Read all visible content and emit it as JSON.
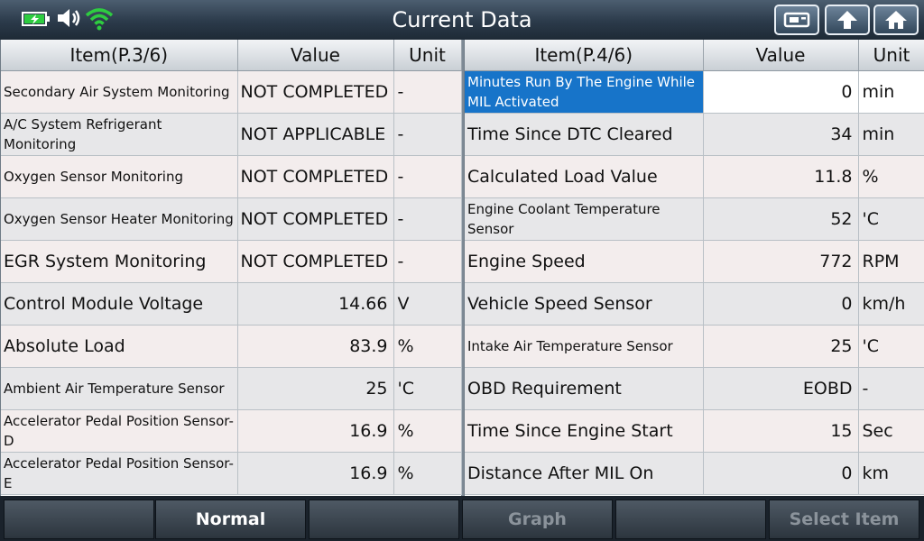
{
  "header": {
    "title": "Current Data"
  },
  "left": {
    "headers": {
      "item": "Item(P.3/6)",
      "value": "Value",
      "unit": "Unit"
    },
    "rows": [
      {
        "item": "Secondary Air System Monitoring",
        "value": "NOT COMPLETED",
        "unit": "-"
      },
      {
        "item": "A/C System Refrigerant Monitoring",
        "value": "NOT APPLICABLE",
        "unit": "-"
      },
      {
        "item": "Oxygen Sensor Monitoring",
        "value": "NOT COMPLETED",
        "unit": "-"
      },
      {
        "item": "Oxygen Sensor Heater Monitoring",
        "value": "NOT COMPLETED",
        "unit": "-"
      },
      {
        "item": "EGR System Monitoring",
        "value": "NOT COMPLETED",
        "unit": "-"
      },
      {
        "item": "Control Module Voltage",
        "value": "14.66",
        "unit": "V"
      },
      {
        "item": "Absolute Load",
        "value": "83.9",
        "unit": "%"
      },
      {
        "item": "Ambient Air Temperature Sensor",
        "value": "25",
        "unit": "'C"
      },
      {
        "item": "Accelerator Pedal Position Sensor-D",
        "value": "16.9",
        "unit": "%"
      },
      {
        "item": "Accelerator Pedal Position Sensor-E",
        "value": "16.9",
        "unit": "%"
      }
    ]
  },
  "right": {
    "headers": {
      "item": "Item(P.4/6)",
      "value": "Value",
      "unit": "Unit"
    },
    "rows": [
      {
        "item": "Minutes Run By The Engine While MIL Activated",
        "value": "0",
        "unit": "min"
      },
      {
        "item": "Time Since DTC Cleared",
        "value": "34",
        "unit": "min"
      },
      {
        "item": "Calculated Load Value",
        "value": "11.8",
        "unit": "%"
      },
      {
        "item": "Engine Coolant Temperature Sensor",
        "value": "52",
        "unit": "'C"
      },
      {
        "item": "Engine Speed",
        "value": "772",
        "unit": "RPM"
      },
      {
        "item": "Vehicle Speed Sensor",
        "value": "0",
        "unit": "km/h"
      },
      {
        "item": "Intake Air Temperature Sensor",
        "value": "25",
        "unit": "'C"
      },
      {
        "item": "OBD Requirement",
        "value": "EOBD",
        "unit": "-"
      },
      {
        "item": "Time Since Engine Start",
        "value": "15",
        "unit": "Sec"
      },
      {
        "item": "Distance After MIL On",
        "value": "0",
        "unit": "km"
      }
    ]
  },
  "bottom": {
    "normal": "Normal",
    "graph": "Graph",
    "select": "Select Item"
  },
  "icons": {
    "battery": "battery-charging-icon",
    "speaker": "speaker-icon",
    "wifi": "wifi-icon",
    "print": "print-icon",
    "back": "back-arrow-icon",
    "home": "home-icon"
  },
  "colors": {
    "selection": "#1774c9",
    "status_green": "#2ecc40"
  }
}
